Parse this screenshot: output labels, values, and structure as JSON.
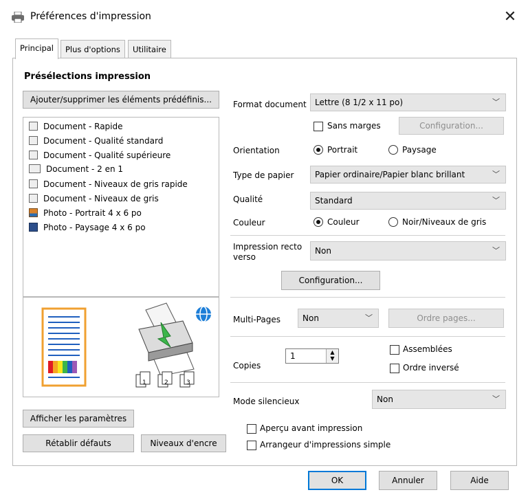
{
  "window": {
    "title": "Préférences d'impression",
    "close_glyph": "✕"
  },
  "tabs": [
    {
      "label": "Principal"
    },
    {
      "label": "Plus d'options"
    },
    {
      "label": "Utilitaire"
    }
  ],
  "presets": {
    "heading": "Présélections impression",
    "manage_button": "Ajouter/supprimer les éléments prédéfinis...",
    "items": [
      {
        "label": "Document - Rapide",
        "icon": "document-icon"
      },
      {
        "label": "Document - Qualité standard",
        "icon": "document-icon"
      },
      {
        "label": "Document - Qualité supérieure",
        "icon": "document-icon"
      },
      {
        "label": "Document - 2 en 1",
        "icon": "two-up-document-icon"
      },
      {
        "label": "Document - Niveaux de gris rapide",
        "icon": "grayscale-document-icon"
      },
      {
        "label": "Document - Niveaux de gris",
        "icon": "grayscale-document-icon"
      },
      {
        "label": "Photo - Portrait 4 x 6 po",
        "icon": "photo-portrait-icon"
      },
      {
        "label": "Photo - Paysage 4 x 6 po",
        "icon": "photo-landscape-icon"
      }
    ]
  },
  "preview": {
    "page_numbers": [
      "1",
      "2",
      "3"
    ]
  },
  "settings": {
    "format_label": "Format document",
    "format_value": "Lettre (8 1/2 x 11 po)",
    "borderless_label": "Sans marges",
    "config_button": "Configuration...",
    "orientation_label": "Orientation",
    "orientation_portrait": "Portrait",
    "orientation_landscape": "Paysage",
    "paper_type_label": "Type de papier",
    "paper_type_value": "Papier ordinaire/Papier blanc brillant",
    "quality_label": "Qualité",
    "quality_value": "Standard",
    "color_label": "Couleur",
    "color_color": "Couleur",
    "color_gray": "Noir/Niveaux de gris",
    "duplex_label_1": "Impression recto",
    "duplex_label_2": "verso",
    "duplex_value": "Non",
    "duplex_config_button": "Configuration...",
    "multipage_label": "Multi-Pages",
    "multipage_value": "Non",
    "page_order_button": "Ordre pages...",
    "copies_label": "Copies",
    "copies_value": "1",
    "collate_label": "Assemblées",
    "reverse_label": "Ordre inversé",
    "quiet_label": "Mode silencieux",
    "quiet_value": "Non",
    "preview_label": "Aperçu avant impression",
    "simple_arranger_label": "Arrangeur d'impressions simple"
  },
  "bottom_left": {
    "show_settings": "Afficher les paramètres",
    "restore_defaults": "Rétablir défauts",
    "ink_levels": "Niveaux d'encre"
  },
  "footer": {
    "ok": "OK",
    "cancel": "Annuler",
    "help": "Aide"
  },
  "colors": {
    "accent": "#0078d7",
    "bg": "#ffffff",
    "button": "#e1e1e1"
  }
}
